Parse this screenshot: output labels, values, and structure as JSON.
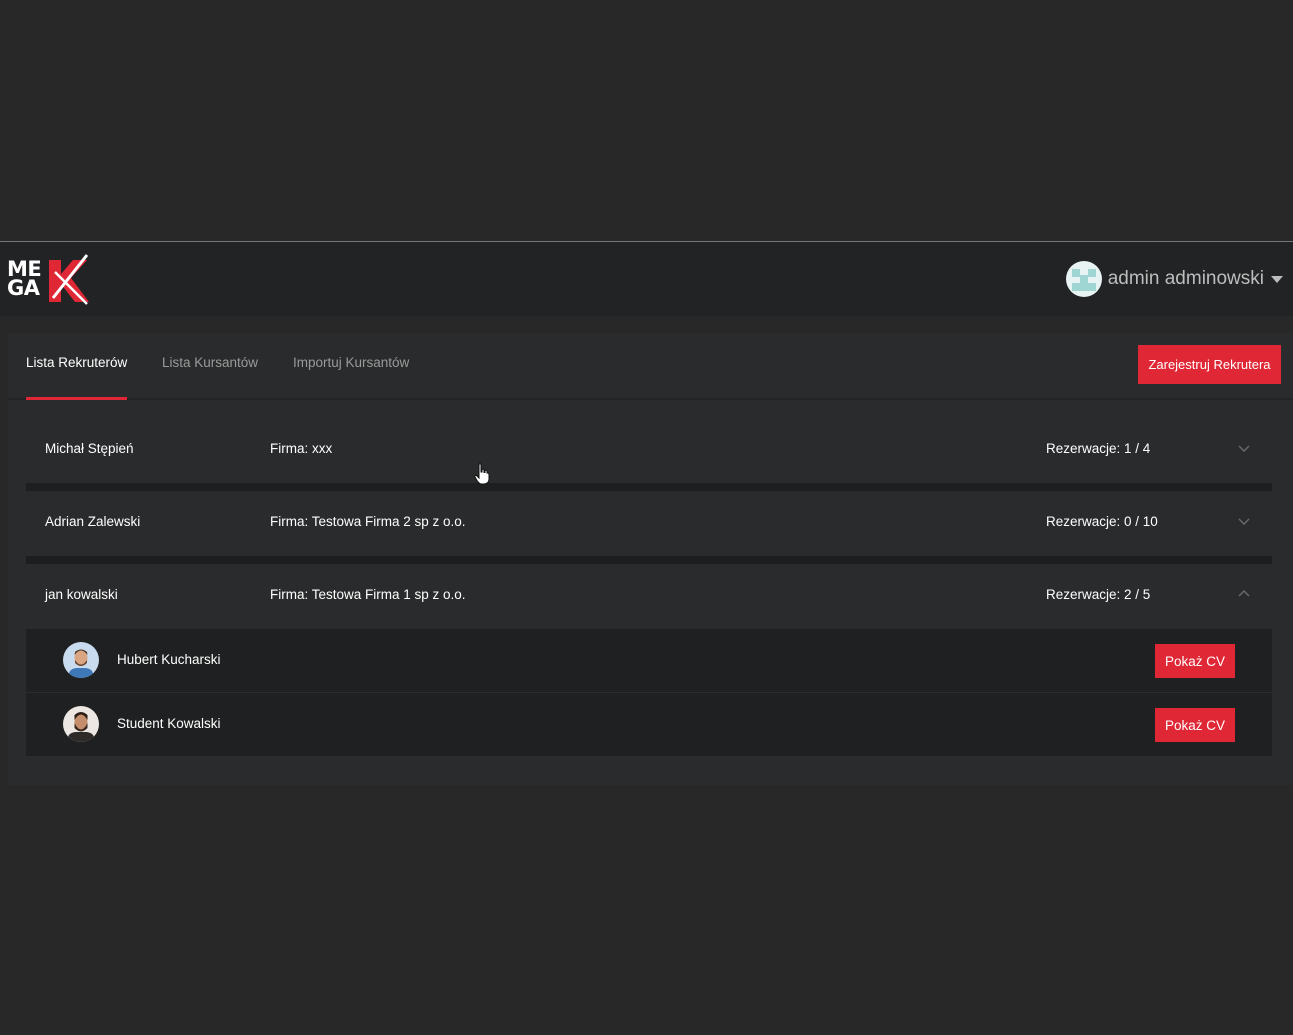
{
  "header": {
    "logo_line1": "ME",
    "logo_line2": "GA",
    "logo_letter": "K",
    "user_name": "admin adminowski"
  },
  "tabs": [
    {
      "label": "Lista Rekruterów",
      "active": true
    },
    {
      "label": "Lista Kursantów",
      "active": false
    },
    {
      "label": "Importuj Kursantów",
      "active": false
    }
  ],
  "register_button": "Zarejestruj Rekrutera",
  "recruiters": [
    {
      "name": "Michał Stępień",
      "firm": "Firma: xxx",
      "reservations": "Rezerwacje: 1 / 4",
      "expanded": false
    },
    {
      "name": "Adrian Zalewski",
      "firm": "Firma: Testowa Firma 2 sp z o.o.",
      "reservations": "Rezerwacje: 0 / 10",
      "expanded": false
    },
    {
      "name": "jan kowalski",
      "firm": "Firma: Testowa Firma 1 sp z o.o.",
      "reservations": "Rezerwacje: 2 / 5",
      "expanded": true
    }
  ],
  "reserved_students": [
    {
      "name": "Hubert Kucharski",
      "button": "Pokaż CV"
    },
    {
      "name": "Student Kowalski",
      "button": "Pokaż CV"
    }
  ],
  "colors": {
    "accent": "#e02735",
    "background": "#282828",
    "header": "#222324",
    "panel": "#2a2b2c"
  },
  "icons": {
    "collapsed": "chevron-down-icon",
    "expanded": "chevron-up-icon",
    "user_menu": "caret-down-icon"
  }
}
